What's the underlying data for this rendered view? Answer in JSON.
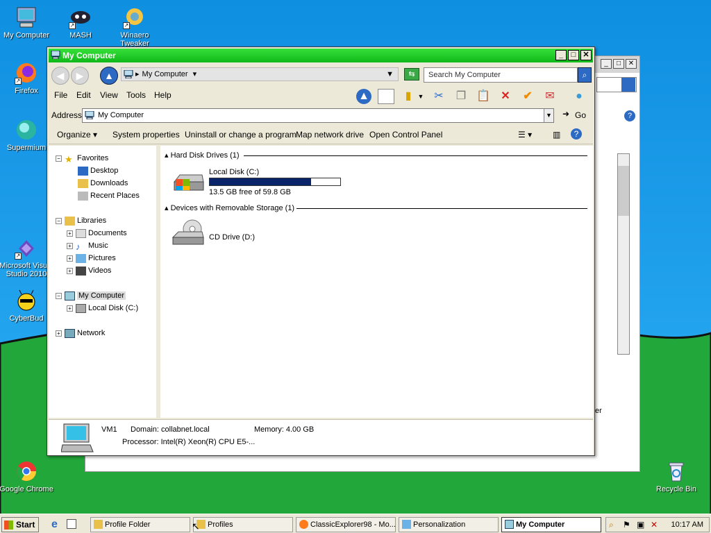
{
  "desktop": {
    "icons": [
      {
        "label": "My Computer"
      },
      {
        "label": "MASH"
      },
      {
        "label": "Winaero Tweaker"
      },
      {
        "label": "Firefox"
      },
      {
        "label": "Supermium"
      },
      {
        "label": "Microsoft Visual Studio 2010"
      },
      {
        "label": "CyberBud"
      },
      {
        "label": "Google Chrome"
      },
      {
        "label": "Recycle Bin"
      }
    ]
  },
  "background_window": {
    "partial_text": "er"
  },
  "window": {
    "title": "My Computer",
    "controls": {
      "minimize": "_",
      "maximize": "□",
      "close": "✕"
    },
    "breadcrumb": "My Computer",
    "search_placeholder": "Search My Computer",
    "menu": [
      "File",
      "Edit",
      "View",
      "Tools",
      "Help"
    ],
    "address_label": "Address",
    "address_value": "My Computer",
    "go_label": "Go",
    "commands": [
      "Organize",
      "System properties",
      "Uninstall or change a program",
      "Map network drive",
      "Open Control Panel"
    ],
    "tree": {
      "favorites": {
        "label": "Favorites",
        "items": [
          "Desktop",
          "Downloads",
          "Recent Places"
        ]
      },
      "libraries": {
        "label": "Libraries",
        "items": [
          "Documents",
          "Music",
          "Pictures",
          "Videos"
        ]
      },
      "computer": {
        "label": "My Computer",
        "items": [
          "Local Disk (C:)"
        ]
      },
      "network": {
        "label": "Network"
      }
    },
    "groups": {
      "hdd": "Hard Disk Drives (1)",
      "removable": "Devices with Removable Storage (1)"
    },
    "drives": {
      "c": {
        "name": "Local Disk (C:)",
        "free_text": "13.5 GB free of 59.8 GB",
        "used_fraction": 0.774
      },
      "d": {
        "name": "CD Drive (D:)"
      }
    },
    "details": {
      "name": "VM1",
      "domain": "Domain: collabnet.local",
      "memory": "Memory: 4.00 GB",
      "processor": "Processor: Intel(R) Xeon(R) CPU E5-..."
    }
  },
  "taskbar": {
    "start": "Start",
    "tasks": [
      "Profile Folder",
      "Profiles",
      "ClassicExplorer98 - Mo...",
      "Personalization",
      "My Computer"
    ],
    "clock": "10:17 AM"
  },
  "colors": {
    "title_green": "#16bb1c",
    "sky": "#1ea0e6",
    "grass": "#22a83a",
    "bar_fill": "#0a246a"
  }
}
